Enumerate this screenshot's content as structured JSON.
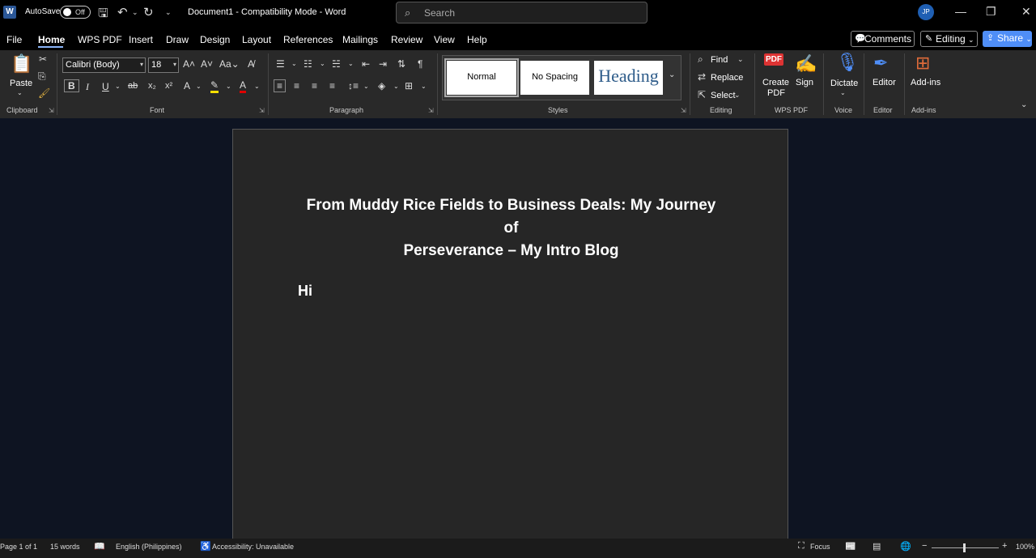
{
  "titlebar": {
    "autosave_label": "AutoSave",
    "autosave_state": "Off",
    "document_title": "Document1  -  Compatibility Mode  -  Word",
    "search_placeholder": "Search",
    "avatar_initials": "JP"
  },
  "menu": {
    "tabs": [
      "File",
      "Home",
      "WPS PDF",
      "Insert",
      "Draw",
      "Design",
      "Layout",
      "References",
      "Mailings",
      "Review",
      "View",
      "Help"
    ],
    "active_tab": "Home",
    "comments_label": "Comments",
    "editing_label": "Editing",
    "share_label": "Share"
  },
  "ribbon": {
    "clipboard": {
      "paste_label": "Paste",
      "group_label": "Clipboard"
    },
    "font": {
      "font_name": "Calibri (Body)",
      "font_size": "18",
      "group_label": "Font"
    },
    "paragraph": {
      "group_label": "Paragraph"
    },
    "styles": {
      "normal": "Normal",
      "no_spacing": "No Spacing",
      "heading": "Heading",
      "group_label": "Styles"
    },
    "editing": {
      "find": "Find",
      "replace": "Replace",
      "select": "Select",
      "group_label": "Editing"
    },
    "wps_pdf": {
      "create_pdf_line1": "Create",
      "create_pdf_line2": "PDF",
      "sign": "Sign",
      "group_label": "WPS PDF"
    },
    "voice": {
      "dictate": "Dictate",
      "group_label": "Voice"
    },
    "editor": {
      "editor": "Editor",
      "group_label": "Editor"
    },
    "addins": {
      "addins": "Add-ins",
      "group_label": "Add-ins"
    }
  },
  "document": {
    "heading_line1": "From Muddy Rice Fields to Business Deals: My Journey of",
    "heading_line2": "Perseverance – My Intro Blog",
    "body": "Hi"
  },
  "statusbar": {
    "page": "Page 1 of 1",
    "words": "15 words",
    "language": "English (Philippines)",
    "accessibility": "Accessibility: Unavailable",
    "focus": "Focus",
    "zoom": "100%"
  },
  "colors": {
    "accent": "#4f8ef7",
    "page_bg": "#262626",
    "canvas_bg": "#0e1422"
  }
}
